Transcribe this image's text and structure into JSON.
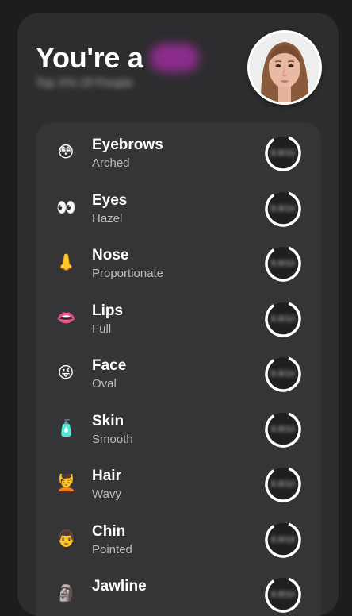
{
  "header": {
    "title": "You're a",
    "subtitle": "Top X% Of People"
  },
  "colors": {
    "background": "#1d1d1f",
    "card": "#2d2d2f",
    "list": "#353537",
    "highlight": "#8b2c8b"
  },
  "features": [
    {
      "name": "Eyebrows",
      "desc": "Arched",
      "emoji": "😳",
      "score": "8.8/10"
    },
    {
      "name": "Eyes",
      "desc": "Hazel",
      "emoji": "👀",
      "score": "8.8/10"
    },
    {
      "name": "Nose",
      "desc": "Proportionate",
      "emoji": "👃",
      "score": "8.8/10"
    },
    {
      "name": "Lips",
      "desc": "Full",
      "emoji": "👄",
      "score": "8.8/10"
    },
    {
      "name": "Face",
      "desc": "Oval",
      "emoji": "😜",
      "score": "8.8/10"
    },
    {
      "name": "Skin",
      "desc": "Smooth",
      "emoji": "🧴",
      "score": "8.8/10"
    },
    {
      "name": "Hair",
      "desc": "Wavy",
      "emoji": "💆",
      "score": "8.8/10"
    },
    {
      "name": "Chin",
      "desc": "Pointed",
      "emoji": "👨",
      "score": "8.8/10"
    },
    {
      "name": "Jawline",
      "desc": "",
      "emoji": "🗿",
      "score": "8.8/10"
    }
  ]
}
